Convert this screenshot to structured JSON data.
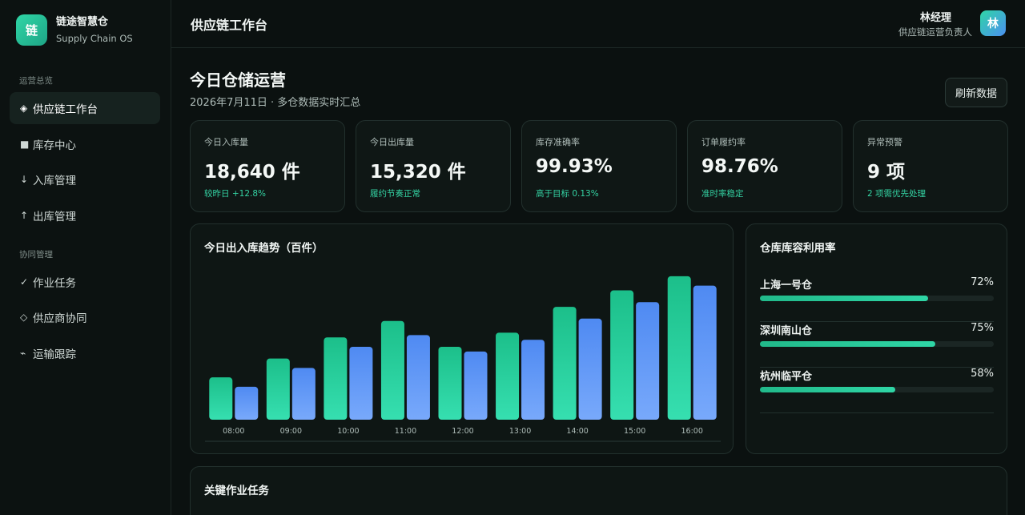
{
  "brand": {
    "logo_text": "链",
    "name": "链途智慧仓",
    "subtitle": "Supply Chain OS"
  },
  "sidebar": {
    "sections": [
      {
        "label": "运营总览"
      },
      {
        "label": "协同管理"
      }
    ],
    "items": [
      {
        "glyph": "◈",
        "label": "供应链工作台",
        "active": true,
        "icon": "diamond-icon"
      },
      {
        "glyph": "■",
        "label": "库存中心",
        "icon": "square-icon"
      },
      {
        "glyph": "↓",
        "label": "入库管理",
        "icon": "arrow-down-icon"
      },
      {
        "glyph": "↑",
        "label": "出库管理",
        "icon": "arrow-up-icon"
      },
      {
        "glyph": "✓",
        "label": "作业任务",
        "icon": "check-icon"
      },
      {
        "glyph": "◇",
        "label": "供应商协同",
        "icon": "diamond-outline-icon"
      },
      {
        "glyph": "⌁",
        "label": "运输跟踪",
        "icon": "route-icon"
      }
    ]
  },
  "header": {
    "title": "供应链工作台",
    "user_name": "林经理",
    "user_role": "供应链运营负责人",
    "avatar_text": "林"
  },
  "page": {
    "title": "今日仓储运营",
    "subtitle": "2026年7月11日 · 多仓数据实时汇总",
    "refresh_label": "刷新数据"
  },
  "kpis": [
    {
      "label": "今日入库量",
      "value": "18,640 件",
      "note": "较昨日 +12.8%"
    },
    {
      "label": "今日出库量",
      "value": "15,320 件",
      "note": "履约节奏正常"
    },
    {
      "label": "库存准确率",
      "value": "99.93%",
      "note": "高于目标 0.13%"
    },
    {
      "label": "订单履约率",
      "value": "98.76%",
      "note": "准时率稳定"
    },
    {
      "label": "异常预警",
      "value": "9 项",
      "note": "2 项需优先处理"
    }
  ],
  "trend_panel": {
    "title": "今日出入库趋势（百件）"
  },
  "chart_data": {
    "type": "bar",
    "categories": [
      "08:00",
      "09:00",
      "10:00",
      "11:00",
      "12:00",
      "13:00",
      "14:00",
      "15:00",
      "16:00"
    ],
    "series": [
      {
        "values": [
          9,
          13,
          17.5,
          21,
          15.5,
          18.5,
          24,
          27.5,
          30.5
        ],
        "color": "#2ad39f"
      },
      {
        "values": [
          7,
          11,
          15.5,
          18,
          14.5,
          17,
          21.5,
          25,
          28.5
        ],
        "color": "#5b95f5"
      }
    ],
    "ylim": [
      0,
      31
    ],
    "grid": false,
    "legend": "none"
  },
  "util_panel": {
    "title": "仓库库容利用率",
    "rows": [
      {
        "name": "上海一号仓",
        "pct_label": "72%",
        "value": 0.72
      },
      {
        "name": "深圳南山仓",
        "pct_label": "75%",
        "value": 0.75
      },
      {
        "name": "杭州临平仓",
        "pct_label": "58%",
        "value": 0.58
      }
    ]
  },
  "tasks_panel": {
    "title": "关键作业任务"
  }
}
